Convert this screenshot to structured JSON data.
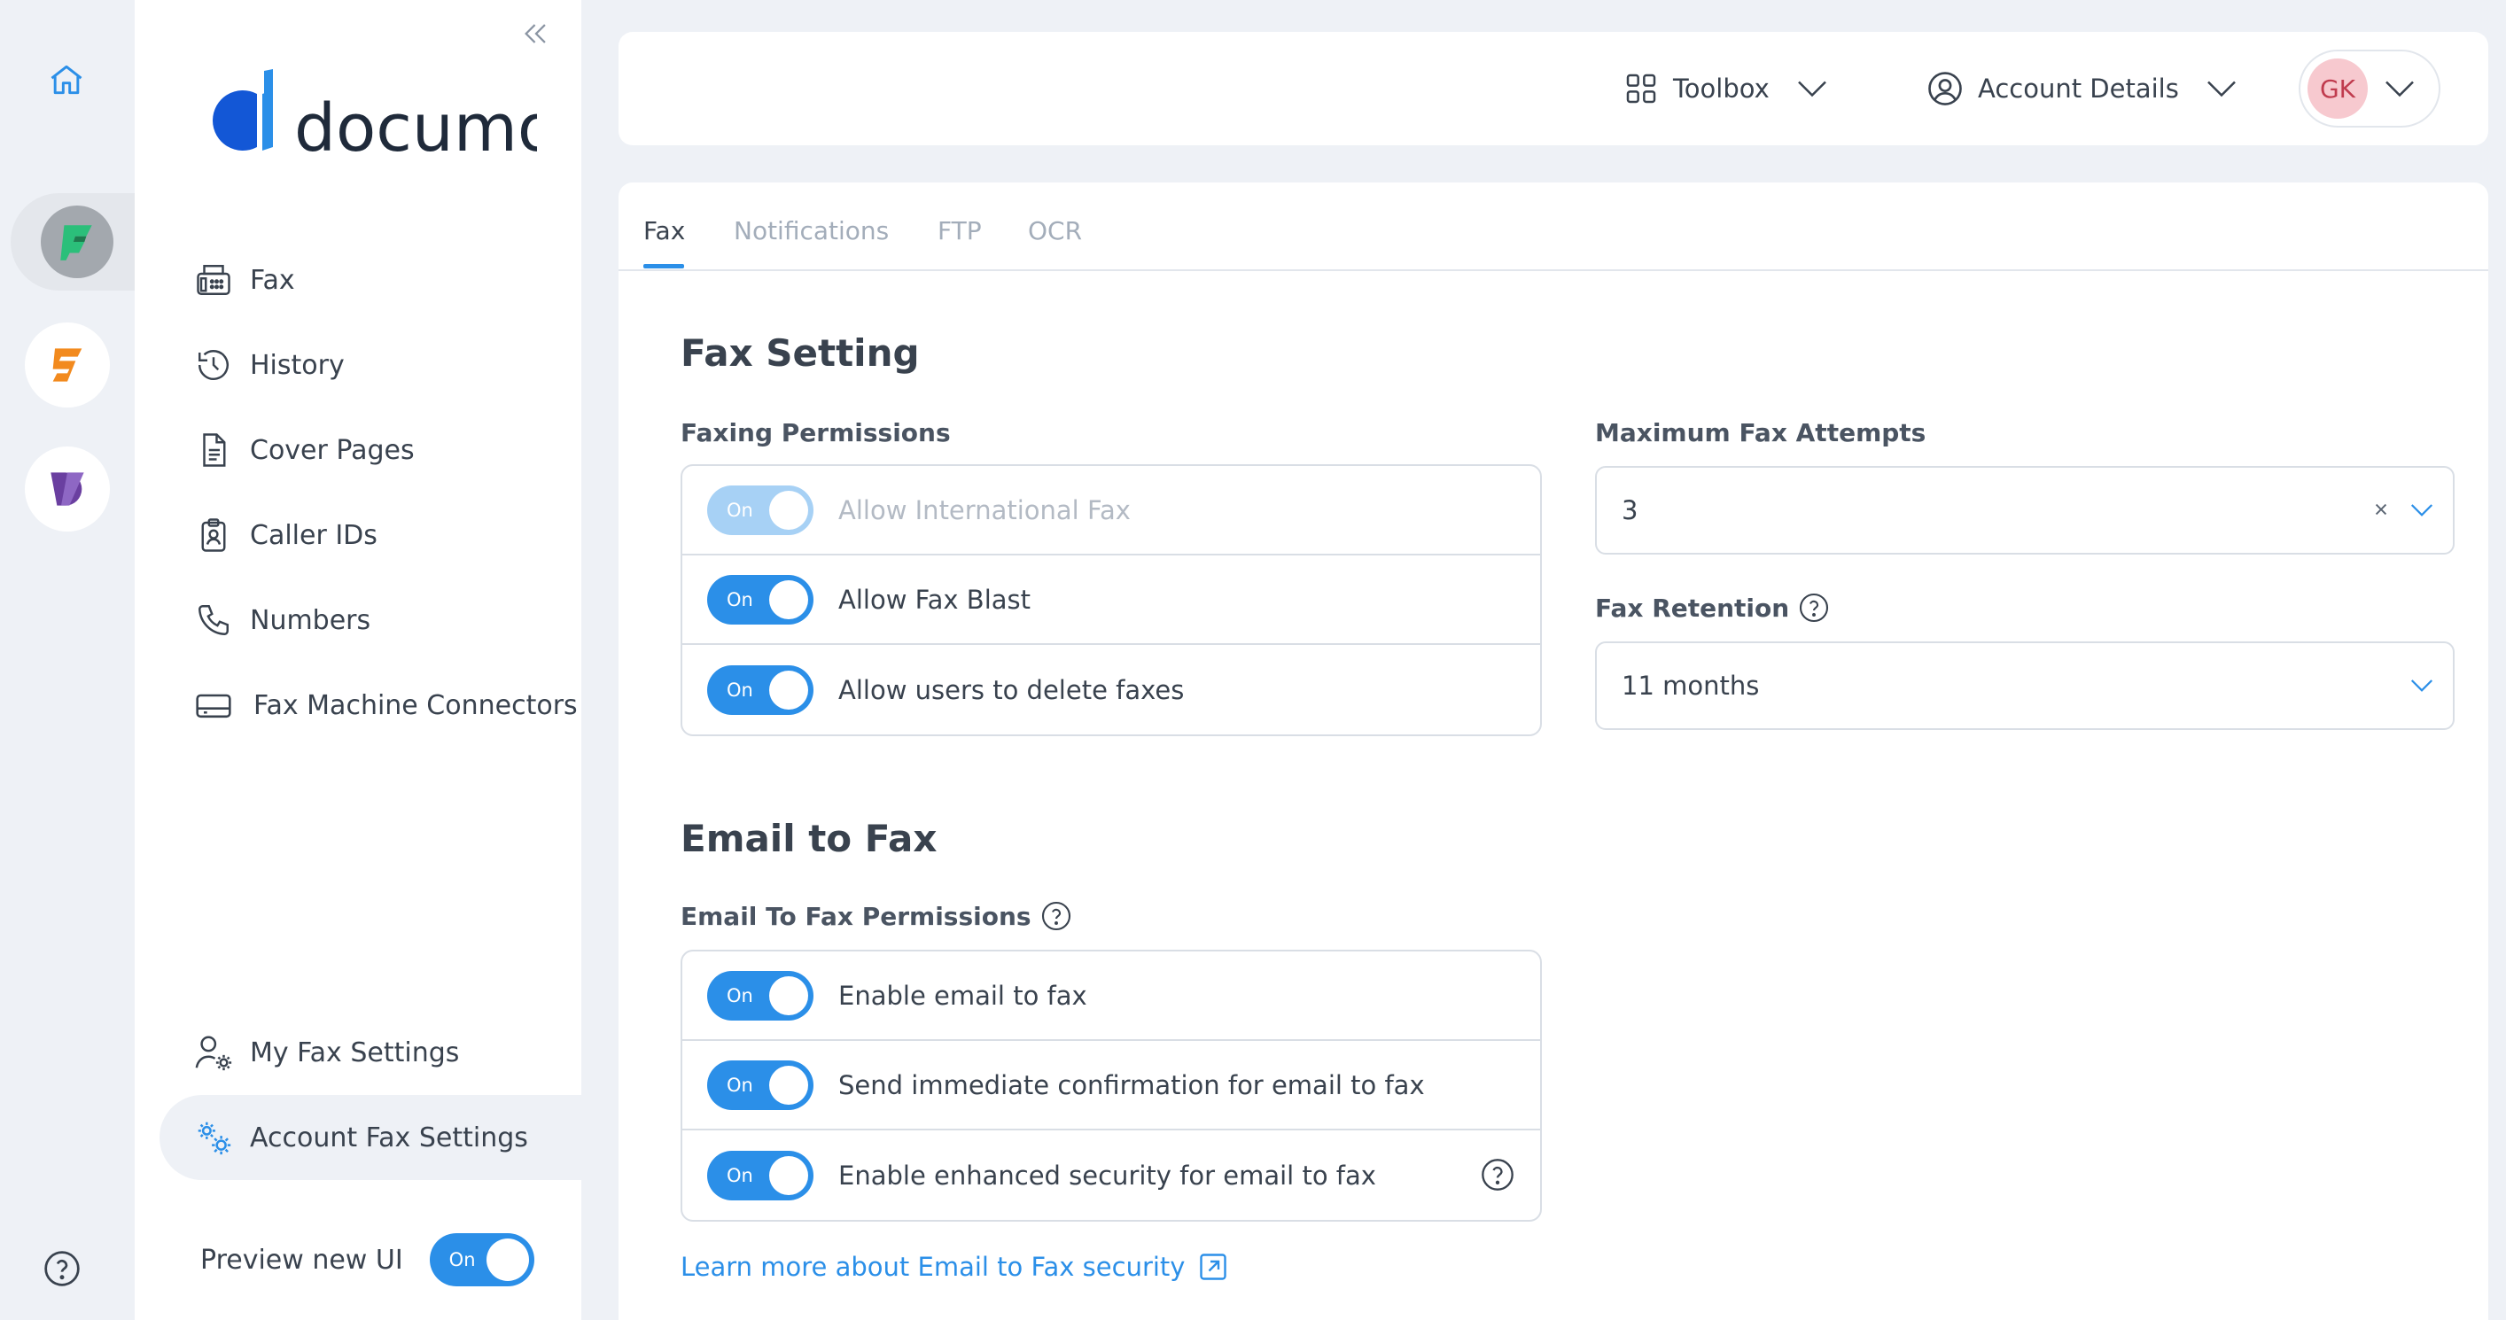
{
  "rail": {
    "apps": [
      {
        "name": "documo-fax-app",
        "active": true
      },
      {
        "name": "documo-sign-app",
        "active": false
      },
      {
        "name": "documo-docs-app",
        "active": false
      }
    ]
  },
  "sidebar": {
    "brand": "documo",
    "nav": [
      {
        "label": "Fax",
        "icon": "fax-icon"
      },
      {
        "label": "History",
        "icon": "history-icon"
      },
      {
        "label": "Cover Pages",
        "icon": "document-icon"
      },
      {
        "label": "Caller IDs",
        "icon": "badge-icon"
      },
      {
        "label": "Numbers",
        "icon": "phone-icon"
      },
      {
        "label": "Fax Machine Connectors",
        "icon": "connector-icon"
      }
    ],
    "bottom_nav": [
      {
        "label": "My Fax Settings",
        "icon": "user-settings-icon"
      },
      {
        "label": "Account Fax Settings",
        "icon": "gears-icon",
        "active": true
      }
    ],
    "preview_label": "Preview new UI",
    "preview_toggle": "On"
  },
  "header": {
    "toolbox_label": "Toolbox",
    "account_label": "Account Details",
    "avatar_initials": "GK"
  },
  "tabs": [
    {
      "label": "Fax",
      "active": true
    },
    {
      "label": "Notifications",
      "active": false
    },
    {
      "label": "FTP",
      "active": false
    },
    {
      "label": "OCR",
      "active": false
    }
  ],
  "fax_setting": {
    "title": "Fax Setting",
    "permissions_label": "Faxing Permissions",
    "permissions": [
      {
        "label": "Allow International Fax",
        "toggle": "On",
        "disabled": true
      },
      {
        "label": "Allow Fax Blast",
        "toggle": "On",
        "disabled": false
      },
      {
        "label": "Allow users to delete faxes",
        "toggle": "On",
        "disabled": false
      }
    ],
    "max_attempts_label": "Maximum Fax Attempts",
    "max_attempts_value": "3",
    "retention_label": "Fax Retention",
    "retention_value": "11 months"
  },
  "email_to_fax": {
    "title": "Email to Fax",
    "permissions_label": "Email To Fax Permissions",
    "permissions": [
      {
        "label": "Enable email to fax",
        "toggle": "On"
      },
      {
        "label": "Send immediate confirmation for email to fax",
        "toggle": "On"
      },
      {
        "label": "Enable enhanced security for email to fax",
        "toggle": "On",
        "help": true
      }
    ],
    "link_label": "Learn more about Email to Fax security"
  },
  "colors": {
    "accent": "#2b8fe8",
    "toggle_disabled": "#a7d1f5",
    "text": "#39424e",
    "avatar_bg": "#f7c9cf",
    "avatar_text": "#c03b4e"
  }
}
